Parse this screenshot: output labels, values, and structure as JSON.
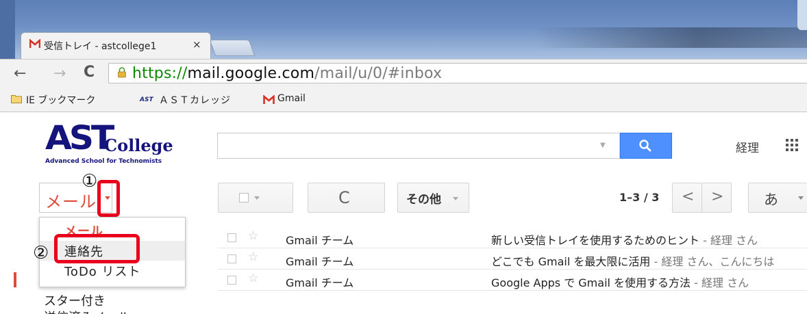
{
  "browser": {
    "tab": {
      "title": "受信トレイ - astcollege1",
      "close": "×"
    },
    "nav": {
      "back": "←",
      "forward": "→",
      "reload": "C"
    },
    "url": {
      "scheme": "https://",
      "host": "mail.google.com",
      "path": "/mail/u/0/#inbox"
    },
    "bookmarks": [
      {
        "label": "IE ブックマーク",
        "icon": "folder-icon"
      },
      {
        "label": "ＡＳＴカレッジ",
        "icon": "ast-icon",
        "icon_text": "AST"
      },
      {
        "label": "Gmail",
        "icon": "gmail-icon"
      }
    ]
  },
  "header": {
    "logo": {
      "main": "AST",
      "sub": "College",
      "tagline": "Advanced School for Technomists"
    },
    "search": {
      "value": "",
      "placeholder": ""
    },
    "account": "経理"
  },
  "mail_switcher": {
    "label": "メール",
    "menu": [
      {
        "label": "メール",
        "state": "selected"
      },
      {
        "label": "連絡先",
        "state": "highlighted"
      },
      {
        "label": "ToDo リスト",
        "state": "normal"
      }
    ]
  },
  "annotations": {
    "one": "①",
    "two": "②",
    "color": "#e8001c"
  },
  "toolbar": {
    "refresh": "C",
    "more": "その他",
    "page_count": "1–3 / 3",
    "prev": "<",
    "next": ">",
    "ime": "あ"
  },
  "nav": {
    "starred": "スター付き",
    "sent": "送信済みメール"
  },
  "messages": [
    {
      "sender": "Gmail チーム",
      "subject": "新しい受信トレイを使用するためのヒント",
      "snippet": " - 経理 さん"
    },
    {
      "sender": "Gmail チーム",
      "subject": "どこでも Gmail を最大限に活用",
      "snippet": " - 経理 さん、こんにちは"
    },
    {
      "sender": "Gmail チーム",
      "subject": "Google Apps で Gmail を使用する方法",
      "snippet": " - 経理 さん"
    }
  ],
  "colors": {
    "brand_red": "#dd4b39",
    "search_blue": "#4d90fe",
    "logo_navy": "#15147d"
  }
}
